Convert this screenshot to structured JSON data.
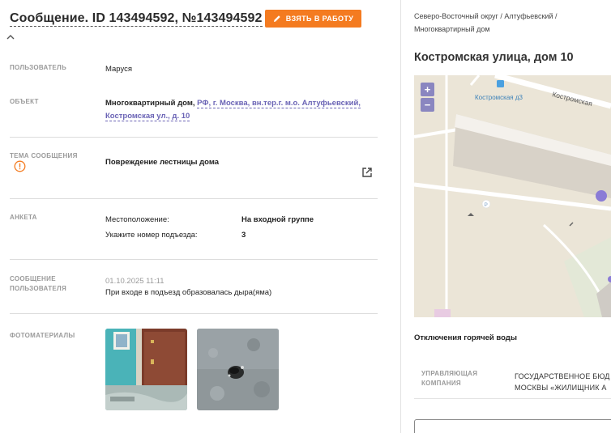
{
  "header": {
    "title": "Сообщение. ID 143494592, №143494592",
    "take_button": "ВЗЯТЬ В РАБОТУ"
  },
  "fields": {
    "user": {
      "label": "ПОЛЬЗОВАТЕЛЬ",
      "value": "Маруся"
    },
    "object": {
      "label": "ОБЪЕКТ",
      "type": "Многоквартирный дом,",
      "address_line1": "РФ, г. Москва, вн.тер.г. м.о. Алтуфьевский,",
      "address_line2": "Костромская ул., д. 10"
    },
    "topic": {
      "label": "ТЕМА СООБЩЕНИЯ",
      "value": "Повреждение лестницы дома"
    },
    "survey": {
      "label": "АНКЕТА",
      "q1": "Местоположение:",
      "a1": "На входной группе",
      "q2": "Укажите номер подъезда:",
      "a2": "3"
    },
    "message": {
      "label_line1": "СООБЩЕНИЕ",
      "label_line2": "ПОЛЬЗОВАТЕЛЯ",
      "date": "01.10.2025 11:11",
      "text": "При входе в подъезд образовалась дыра(яма)"
    },
    "photos": {
      "label": "ФОТОМАТЕРИАЛЫ"
    }
  },
  "right": {
    "breadcrumb_line1": "Северо-Восточный округ / Алтуфьевский /",
    "breadcrumb_line2": "Многоквартирный дом",
    "address": "Костромская улица, дом 10",
    "map": {
      "bus_stop": "Костромская д3",
      "street": "Костромская",
      "zoom_in": "+",
      "zoom_out": "−",
      "parking": "P"
    },
    "section_title": "Отключения горячей воды",
    "uk_label": "УПРАВЛЯЮЩАЯ КОМПАНИЯ",
    "uk_value_line1": "ГОСУДАРСТВЕННОЕ БЮД",
    "uk_value_line2": "МОСКВЫ «ЖИЛИЩНИК А"
  },
  "colors": {
    "accent": "#f47b20",
    "link": "#6a63b5",
    "marker": "#8a7bd6",
    "warning": "#f47b20"
  }
}
